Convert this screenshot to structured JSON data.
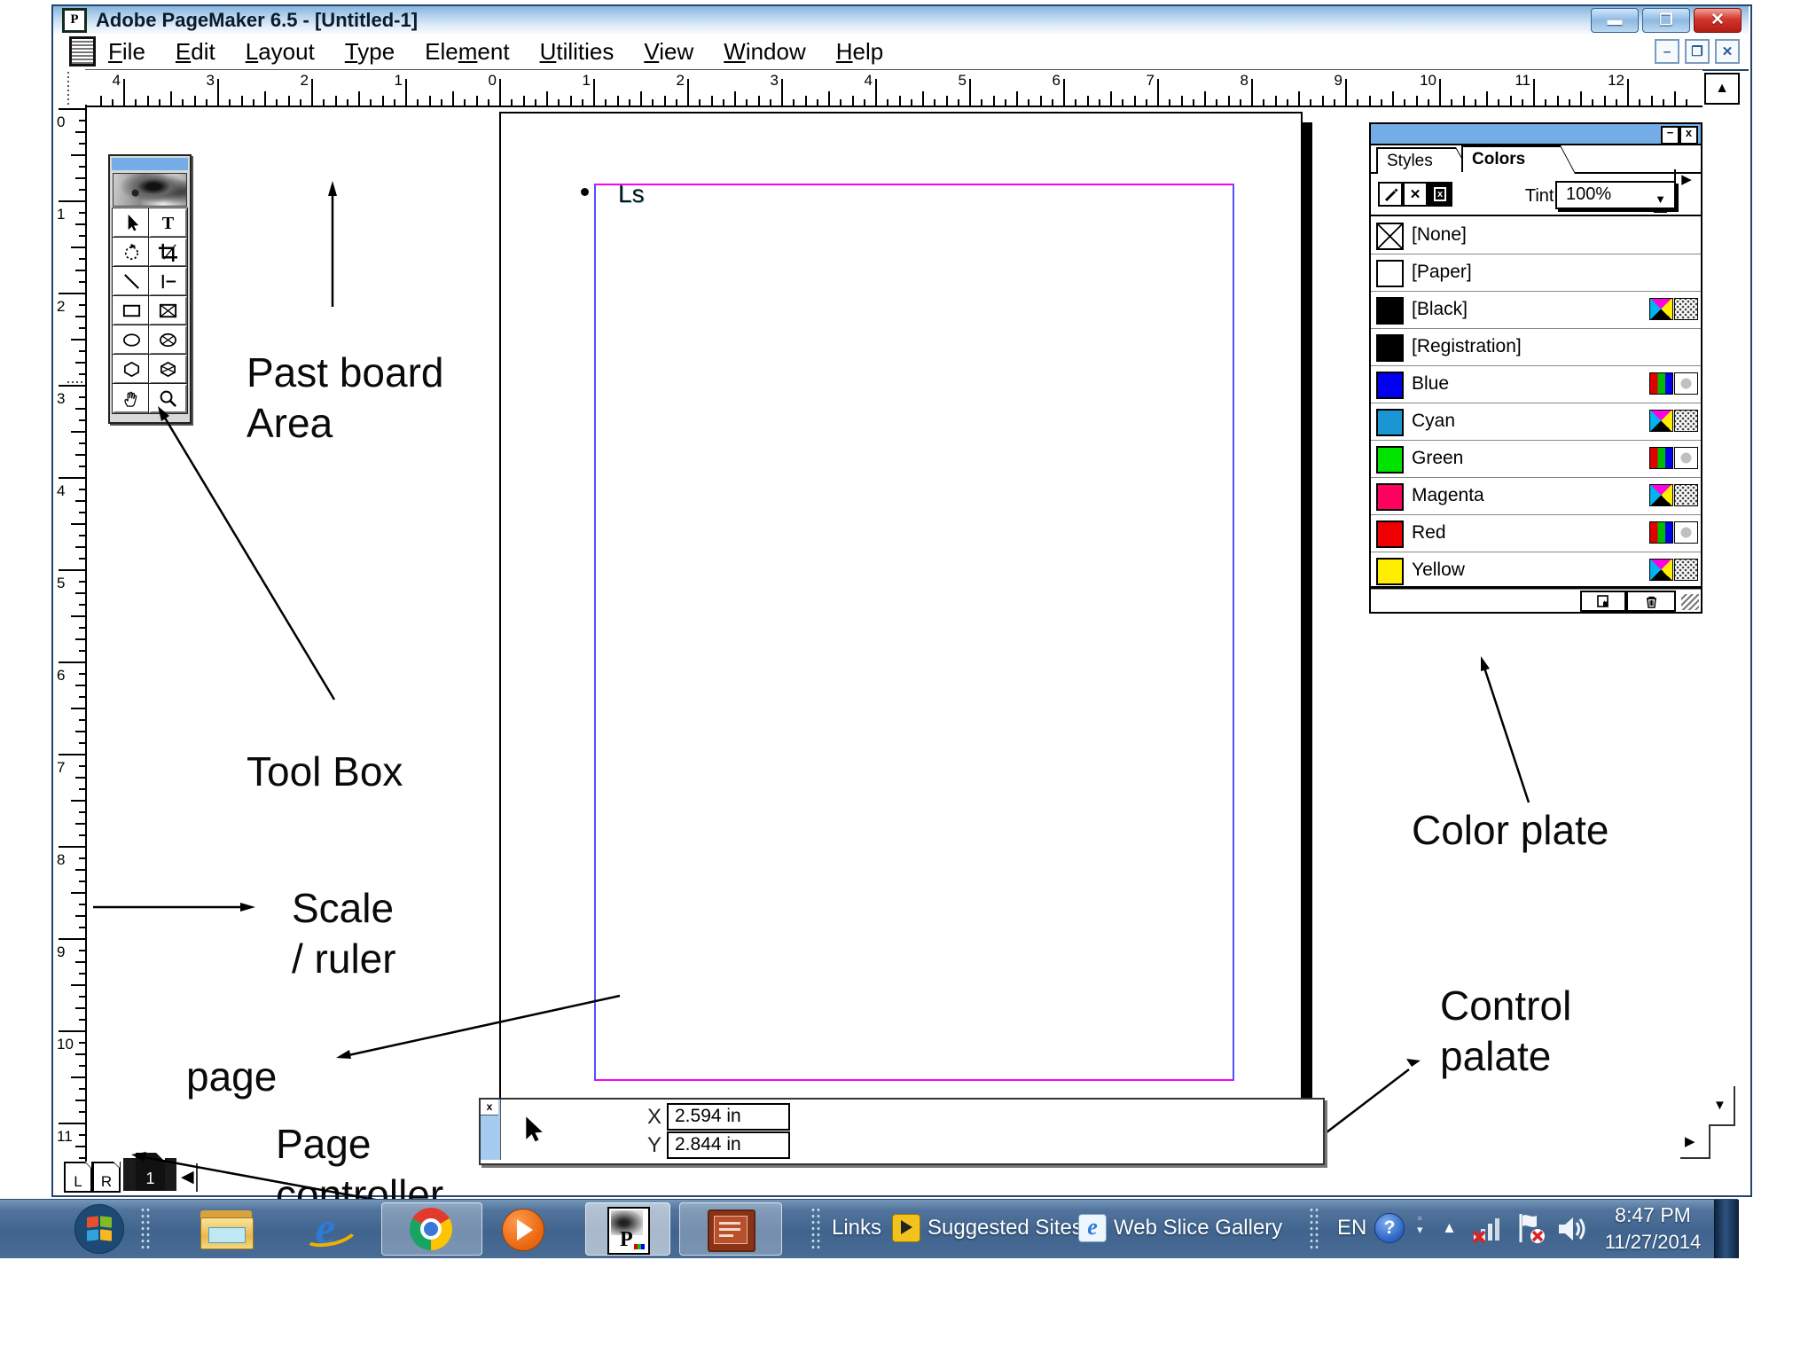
{
  "window": {
    "title": "Adobe PageMaker 6.5 - [Untitled-1]",
    "app_icon": "P"
  },
  "menu_bar": {
    "items": [
      {
        "label": "File",
        "underline": "F"
      },
      {
        "label": "Edit",
        "underline": "E"
      },
      {
        "label": "Layout",
        "underline": "L"
      },
      {
        "label": "Type",
        "underline": "T"
      },
      {
        "label": "Element",
        "underline": "m"
      },
      {
        "label": "Utilities",
        "underline": "U"
      },
      {
        "label": "View",
        "underline": "V"
      },
      {
        "label": "Window",
        "underline": "W"
      },
      {
        "label": "Help",
        "underline": "H"
      }
    ]
  },
  "rulers": {
    "horizontal_numbers": [
      "4",
      "3",
      "2",
      "1",
      "0",
      "1",
      "2",
      "3",
      "4",
      "5",
      "6",
      "7",
      "8",
      "9",
      "10",
      "11",
      "12"
    ],
    "vertical_numbers": [
      "0",
      "1",
      "2",
      "3",
      "4",
      "5",
      "6",
      "7",
      "8",
      "9",
      "10",
      "11"
    ]
  },
  "toolbox": {
    "tools": [
      {
        "name": "pointer"
      },
      {
        "name": "text"
      },
      {
        "name": "rotate"
      },
      {
        "name": "crop"
      },
      {
        "name": "line"
      },
      {
        "name": "constrained-line"
      },
      {
        "name": "rectangle"
      },
      {
        "name": "rectangle-frame"
      },
      {
        "name": "ellipse"
      },
      {
        "name": "ellipse-frame"
      },
      {
        "name": "polygon"
      },
      {
        "name": "polygon-frame"
      },
      {
        "name": "hand"
      },
      {
        "name": "zoom"
      }
    ]
  },
  "document": {
    "page_text": "Ls"
  },
  "colors_palette": {
    "minimize": "−",
    "close": "x",
    "tabs": [
      {
        "label": "Styles",
        "active": false
      },
      {
        "label": "Colors",
        "active": true
      }
    ],
    "tint_label": "Tint:",
    "tint_value": "100%",
    "colors": [
      {
        "name": "[None]",
        "swatch": "none",
        "icons": []
      },
      {
        "name": "[Paper]",
        "swatch": "#ffffff",
        "icons": []
      },
      {
        "name": "[Black]",
        "swatch": "#000000",
        "icons": [
          "cmyk",
          "halftone"
        ]
      },
      {
        "name": "[Registration]",
        "swatch": "#000000",
        "icons": []
      },
      {
        "name": "Blue",
        "swatch": "#0000ee",
        "icons": [
          "rgb",
          "circle"
        ]
      },
      {
        "name": "Cyan",
        "swatch": "#1a96d4",
        "icons": [
          "cmyk",
          "halftone"
        ]
      },
      {
        "name": "Green",
        "swatch": "#00e400",
        "icons": [
          "rgb",
          "circle"
        ]
      },
      {
        "name": "Magenta",
        "swatch": "#ff0060",
        "icons": [
          "cmyk",
          "halftone"
        ]
      },
      {
        "name": "Red",
        "swatch": "#f00000",
        "icons": [
          "rgb",
          "circle"
        ]
      },
      {
        "name": "Yellow",
        "swatch": "#ffee00",
        "icons": [
          "cmyk",
          "halftone"
        ]
      }
    ]
  },
  "control_palette": {
    "close": "x",
    "x_label": "X",
    "x_value": "2.594 in",
    "y_label": "Y",
    "y_value": "2.844 in"
  },
  "page_navigator": {
    "left_master": "L",
    "right_master": "R",
    "current_page": "1"
  },
  "taskbar": {
    "links": "Links",
    "suggested_sites": "Suggested Sites",
    "web_slice_gallery": "Web Slice Gallery",
    "language": "EN",
    "time": "8:47 PM",
    "date": "11/27/2014"
  },
  "annotations": {
    "pasteboard": {
      "line1": "Past board",
      "line2": "Area"
    },
    "toolbox": {
      "line1": "Tool Box"
    },
    "scale": {
      "line1": "Scale",
      "line2": "/ ruler"
    },
    "page": {
      "line1": "page"
    },
    "page_controller": {
      "line1": "Page",
      "line2": "controller"
    },
    "color_plate": {
      "line1": "Color plate"
    },
    "control_palette": {
      "line1": "Control",
      "line2": "palate"
    }
  }
}
